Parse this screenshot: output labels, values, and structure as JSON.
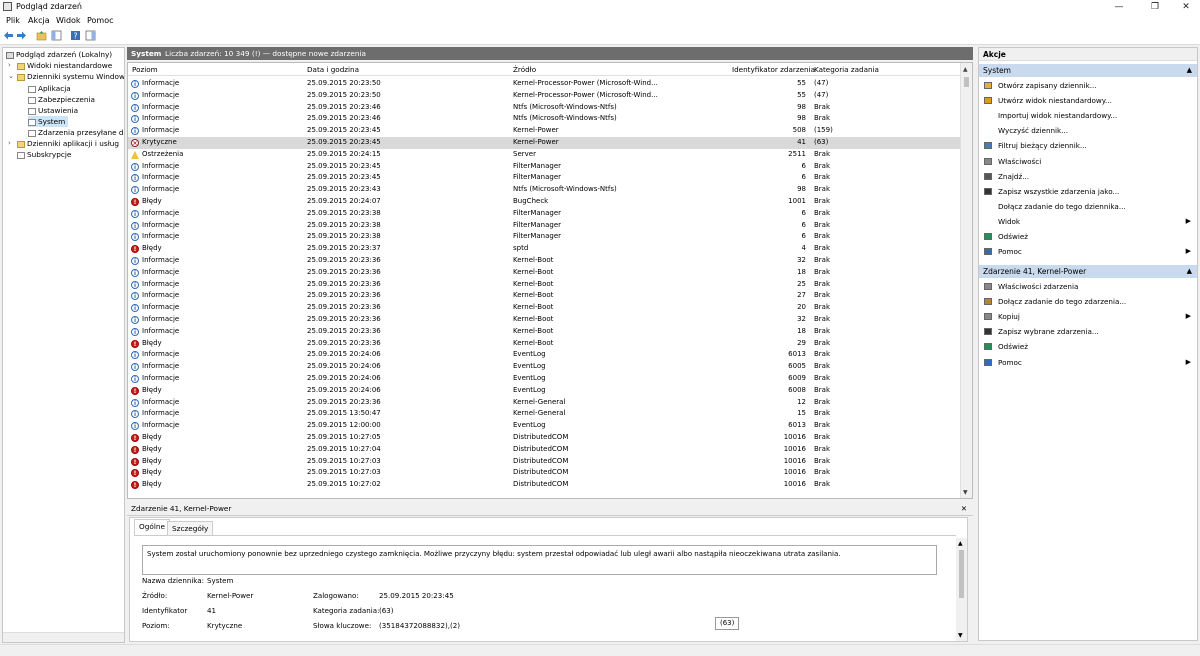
{
  "window": {
    "title": "Podgląd zdarzeń",
    "min": "—",
    "max": "❐",
    "close": "✕"
  },
  "menu": [
    "Plik",
    "Akcja",
    "Widok",
    "Pomoc"
  ],
  "tree": {
    "items": [
      {
        "label": "Podgląd zdarzeń (Lokalny)",
        "indent": 0,
        "exp": ""
      },
      {
        "label": "Widoki niestandardowe",
        "indent": 1,
        "exp": "›"
      },
      {
        "label": "Dzienniki systemu Windows",
        "indent": 1,
        "exp": "⌄"
      },
      {
        "label": "Aplikacja",
        "indent": 2,
        "exp": ""
      },
      {
        "label": "Zabezpieczenia",
        "indent": 2,
        "exp": ""
      },
      {
        "label": "Ustawienia",
        "indent": 2,
        "exp": ""
      },
      {
        "label": "System",
        "indent": 2,
        "exp": "",
        "selected": true
      },
      {
        "label": "Zdarzenia przesyłane dalej",
        "indent": 2,
        "exp": ""
      },
      {
        "label": "Dzienniki aplikacji i usług",
        "indent": 1,
        "exp": "›"
      },
      {
        "label": "Subskrypcje",
        "indent": 1,
        "exp": ""
      }
    ]
  },
  "center": {
    "log_name": "System",
    "count_text": "Liczba zdarzeń: 10 349 (!) — dostępne nowe zdarzenia",
    "columns": [
      "Poziom",
      "Data i godzina",
      "Źródło",
      "Identyfikator zdarzenia",
      "Kategoria zadania"
    ]
  },
  "events": [
    {
      "level": "Informacje",
      "type": "info",
      "date": "25.09.2015 20:23:50",
      "source": "Kernel-Processor-Power (Microsoft-Wind...",
      "id": "55",
      "cat": "(47)"
    },
    {
      "level": "Informacje",
      "type": "info",
      "date": "25.09.2015 20:23:50",
      "source": "Kernel-Processor-Power (Microsoft-Wind...",
      "id": "55",
      "cat": "(47)"
    },
    {
      "level": "Informacje",
      "type": "info",
      "date": "25.09.2015 20:23:46",
      "source": "Ntfs (Microsoft-Windows-Ntfs)",
      "id": "98",
      "cat": "Brak"
    },
    {
      "level": "Informacje",
      "type": "info",
      "date": "25.09.2015 20:23:46",
      "source": "Ntfs (Microsoft-Windows-Ntfs)",
      "id": "98",
      "cat": "Brak"
    },
    {
      "level": "Informacje",
      "type": "info",
      "date": "25.09.2015 20:23:45",
      "source": "Kernel-Power",
      "id": "508",
      "cat": "(159)"
    },
    {
      "level": "Krytyczne",
      "type": "crit",
      "date": "25.09.2015 20:23:45",
      "source": "Kernel-Power",
      "id": "41",
      "cat": "(63)",
      "selected": true
    },
    {
      "level": "Ostrzeżenia",
      "type": "warn",
      "date": "25.09.2015 20:24:15",
      "source": "Server",
      "id": "2511",
      "cat": "Brak"
    },
    {
      "level": "Informacje",
      "type": "info",
      "date": "25.09.2015 20:23:45",
      "source": "FilterManager",
      "id": "6",
      "cat": "Brak"
    },
    {
      "level": "Informacje",
      "type": "info",
      "date": "25.09.2015 20:23:45",
      "source": "FilterManager",
      "id": "6",
      "cat": "Brak"
    },
    {
      "level": "Informacje",
      "type": "info",
      "date": "25.09.2015 20:23:43",
      "source": "Ntfs (Microsoft-Windows-Ntfs)",
      "id": "98",
      "cat": "Brak"
    },
    {
      "level": "Błędy",
      "type": "err",
      "date": "25.09.2015 20:24:07",
      "source": "BugCheck",
      "id": "1001",
      "cat": "Brak"
    },
    {
      "level": "Informacje",
      "type": "info",
      "date": "25.09.2015 20:23:38",
      "source": "FilterManager",
      "id": "6",
      "cat": "Brak"
    },
    {
      "level": "Informacje",
      "type": "info",
      "date": "25.09.2015 20:23:38",
      "source": "FilterManager",
      "id": "6",
      "cat": "Brak"
    },
    {
      "level": "Informacje",
      "type": "info",
      "date": "25.09.2015 20:23:38",
      "source": "FilterManager",
      "id": "6",
      "cat": "Brak"
    },
    {
      "level": "Błędy",
      "type": "err",
      "date": "25.09.2015 20:23:37",
      "source": "sptd",
      "id": "4",
      "cat": "Brak"
    },
    {
      "level": "Informacje",
      "type": "info",
      "date": "25.09.2015 20:23:36",
      "source": "Kernel-Boot",
      "id": "32",
      "cat": "Brak"
    },
    {
      "level": "Informacje",
      "type": "info",
      "date": "25.09.2015 20:23:36",
      "source": "Kernel-Boot",
      "id": "18",
      "cat": "Brak"
    },
    {
      "level": "Informacje",
      "type": "info",
      "date": "25.09.2015 20:23:36",
      "source": "Kernel-Boot",
      "id": "25",
      "cat": "Brak"
    },
    {
      "level": "Informacje",
      "type": "info",
      "date": "25.09.2015 20:23:36",
      "source": "Kernel-Boot",
      "id": "27",
      "cat": "Brak"
    },
    {
      "level": "Informacje",
      "type": "info",
      "date": "25.09.2015 20:23:36",
      "source": "Kernel-Boot",
      "id": "20",
      "cat": "Brak"
    },
    {
      "level": "Informacje",
      "type": "info",
      "date": "25.09.2015 20:23:36",
      "source": "Kernel-Boot",
      "id": "32",
      "cat": "Brak"
    },
    {
      "level": "Informacje",
      "type": "info",
      "date": "25.09.2015 20:23:36",
      "source": "Kernel-Boot",
      "id": "18",
      "cat": "Brak"
    },
    {
      "level": "Błędy",
      "type": "err",
      "date": "25.09.2015 20:23:36",
      "source": "Kernel-Boot",
      "id": "29",
      "cat": "Brak"
    },
    {
      "level": "Informacje",
      "type": "info",
      "date": "25.09.2015 20:24:06",
      "source": "EventLog",
      "id": "6013",
      "cat": "Brak"
    },
    {
      "level": "Informacje",
      "type": "info",
      "date": "25.09.2015 20:24:06",
      "source": "EventLog",
      "id": "6005",
      "cat": "Brak"
    },
    {
      "level": "Informacje",
      "type": "info",
      "date": "25.09.2015 20:24:06",
      "source": "EventLog",
      "id": "6009",
      "cat": "Brak"
    },
    {
      "level": "Błędy",
      "type": "err",
      "date": "25.09.2015 20:24:06",
      "source": "EventLog",
      "id": "6008",
      "cat": "Brak"
    },
    {
      "level": "Informacje",
      "type": "info",
      "date": "25.09.2015 20:23:36",
      "source": "Kernel-General",
      "id": "12",
      "cat": "Brak"
    },
    {
      "level": "Informacje",
      "type": "info",
      "date": "25.09.2015 13:50:47",
      "source": "Kernel-General",
      "id": "15",
      "cat": "Brak"
    },
    {
      "level": "Informacje",
      "type": "info",
      "date": "25.09.2015 12:00:00",
      "source": "EventLog",
      "id": "6013",
      "cat": "Brak"
    },
    {
      "level": "Błędy",
      "type": "err",
      "date": "25.09.2015 10:27:05",
      "source": "DistributedCOM",
      "id": "10016",
      "cat": "Brak"
    },
    {
      "level": "Błędy",
      "type": "err",
      "date": "25.09.2015 10:27:04",
      "source": "DistributedCOM",
      "id": "10016",
      "cat": "Brak"
    },
    {
      "level": "Błędy",
      "type": "err",
      "date": "25.09.2015 10:27:03",
      "source": "DistributedCOM",
      "id": "10016",
      "cat": "Brak"
    },
    {
      "level": "Błędy",
      "type": "err",
      "date": "25.09.2015 10:27:03",
      "source": "DistributedCOM",
      "id": "10016",
      "cat": "Brak"
    },
    {
      "level": "Błędy",
      "type": "err",
      "date": "25.09.2015 10:27:02",
      "source": "DistributedCOM",
      "id": "10016",
      "cat": "Brak"
    }
  ],
  "detail": {
    "title": "Zdarzenie 41, Kernel-Power",
    "close": "✕",
    "tabs": [
      "Ogólne",
      "Szczegóły"
    ],
    "message": "System został uruchomiony ponownie bez uprzedniego czystego zamknięcia. Możliwe przyczyny błędu: system przestał odpowiadać lub uległ awarii albo nastąpiła nieoczekiwana utrata zasilania.",
    "log_name_label": "Nazwa dziennika:",
    "log_name": "System",
    "source_label": "Źródło:",
    "source": "Kernel-Power",
    "logged_label": "Zalogowano:",
    "logged": "25.09.2015 20:23:45",
    "id_label": "Identyfikator",
    "id": "41",
    "category_label": "Kategoria zadania:",
    "category": "(63)",
    "level_label": "Poziom:",
    "level": "Krytyczne",
    "keywords_label": "Słowa kluczowe:",
    "keywords": "(35184372088832),(2)"
  },
  "tooltip": "(63)",
  "actions": {
    "title": "Akcje",
    "section1": "System",
    "items1": [
      {
        "label": "Otwórz zapisany dziennik...",
        "icon": "folder-open-icon",
        "color": "#e2b13c"
      },
      {
        "label": "Utwórz widok niestandardowy...",
        "icon": "filter-icon",
        "color": "#d4a017"
      },
      {
        "label": "Importuj widok niestandardowy...",
        "icon": "",
        "color": ""
      },
      {
        "label": "Wyczyść dziennik...",
        "icon": "",
        "color": ""
      },
      {
        "label": "Filtruj bieżący dziennik...",
        "icon": "filter-icon",
        "color": "#4a7db8"
      },
      {
        "label": "Właściwości",
        "icon": "properties-icon",
        "color": "#888888"
      },
      {
        "label": "Znajdź...",
        "icon": "find-icon",
        "color": "#555555"
      },
      {
        "label": "Zapisz wszystkie zdarzenia jako...",
        "icon": "save-icon",
        "color": "#333333"
      },
      {
        "label": "Dołącz zadanie do tego dziennika...",
        "icon": "",
        "color": ""
      },
      {
        "label": "Widok",
        "icon": "",
        "color": "",
        "sub": "▶"
      },
      {
        "label": "Odśwież",
        "icon": "refresh-icon",
        "color": "#2e8b57"
      },
      {
        "label": "Pomoc",
        "icon": "help-icon",
        "color": "#2e6eb5",
        "sub": "▶"
      }
    ],
    "section2": "Zdarzenie 41, Kernel-Power",
    "items2": [
      {
        "label": "Właściwości zdarzenia",
        "icon": "event-properties-icon",
        "color": "#888888"
      },
      {
        "label": "Dołącz zadanie do tego zdarzenia...",
        "icon": "task-icon",
        "color": "#b8862e"
      },
      {
        "label": "Kopiuj",
        "icon": "copy-icon",
        "color": "#888888",
        "sub": "▶"
      },
      {
        "label": "Zapisz wybrane zdarzenia...",
        "icon": "save-icon",
        "color": "#333333"
      },
      {
        "label": "Odśwież",
        "icon": "refresh-icon",
        "color": "#2e8b57"
      },
      {
        "label": "Pomoc",
        "icon": "help-icon",
        "color": "#2e6eb5",
        "sub": "▶"
      }
    ]
  },
  "colors": {
    "header_bg": "#6d6d6d",
    "section_bg": "#c9d9ee",
    "selected_row": "#d9d9d9",
    "tree_selected": "#cce4f7"
  }
}
